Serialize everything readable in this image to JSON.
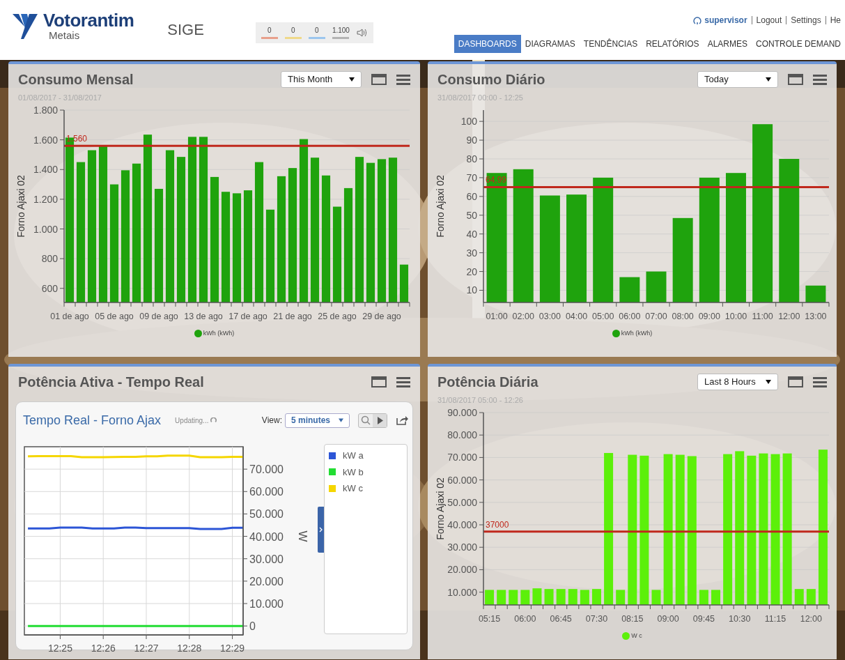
{
  "header": {
    "brand": "Votorantim",
    "brand_subtitle": "Metais",
    "app_name": "SIGE",
    "counters": [
      {
        "value": "0",
        "color": "#e8a08c"
      },
      {
        "value": "0",
        "color": "#efd98a"
      },
      {
        "value": "0",
        "color": "#9cc6ee"
      },
      {
        "value": "1.100",
        "color": "#b4b4b4"
      }
    ],
    "user": "supervisor",
    "links": [
      "Logout",
      "Settings",
      "He"
    ],
    "nav": [
      {
        "label": "DASHBOARDS",
        "selected": true
      },
      {
        "label": "DIAGRAMAS",
        "selected": false
      },
      {
        "label": "TENDÊNCIAS",
        "selected": false
      },
      {
        "label": "RELATÓRIOS",
        "selected": false
      },
      {
        "label": "ALARMES",
        "selected": false
      },
      {
        "label": "CONTROLE DEMAND",
        "selected": false
      }
    ]
  },
  "panels": [
    {
      "kind": "bar",
      "title": "Consumo Mensal",
      "period": "This Month",
      "date_range": "01/08/2017 - 31/08/2017",
      "chart_data": {
        "type": "bar",
        "ylabel": "Forno Ajaxi 02",
        "grid": true,
        "categories": [
          "01 de ago",
          null,
          null,
          null,
          "05 de ago",
          null,
          null,
          null,
          "09 de ago",
          null,
          null,
          null,
          "13 de ago",
          null,
          null,
          null,
          "17 de ago",
          null,
          null,
          null,
          "21 de ago",
          null,
          null,
          null,
          "25 de ago",
          null,
          null,
          null,
          "29 de ago",
          null,
          null
        ],
        "series": [
          {
            "name": "kWh (kWh)",
            "color": "#1fa30d",
            "values": [
              1615,
              1450,
              1530,
              1560,
              1300,
              1395,
              1440,
              1635,
              1270,
              1530,
              1485,
              1620,
              1620,
              1350,
              1250,
              1240,
              1260,
              1450,
              1130,
              1355,
              1410,
              1605,
              1480,
              1360,
              1150,
              1275,
              1485,
              1445,
              1470,
              1480,
              760
            ]
          }
        ],
        "ylim": [
          505,
          1800
        ],
        "yticks": [
          {
            "value": 600,
            "label": "600"
          },
          {
            "value": 800,
            "label": "800"
          },
          {
            "value": 1000,
            "label": "1.000"
          },
          {
            "value": 1200,
            "label": "1.200"
          },
          {
            "value": 1400,
            "label": "1.400"
          },
          {
            "value": 1600,
            "label": "1.600"
          },
          {
            "value": 1800,
            "label": "1.800"
          }
        ],
        "ref_lines": [
          {
            "axis": "y",
            "value": 1560,
            "label": "1.560",
            "color": "#c0281c"
          }
        ]
      }
    },
    {
      "kind": "bar",
      "title": "Consumo Diário",
      "period": "Today",
      "date_range": "31/08/2017 00:00 - 12:25",
      "chart_data": {
        "type": "bar",
        "ylabel": "Forno Ajaxi 02",
        "grid": true,
        "categories": [
          "01:00",
          "02:00",
          "03:00",
          "04:00",
          "05:00",
          "06:00",
          "07:00",
          "08:00",
          "09:00",
          "10:00",
          "11:00",
          "12:00",
          "13:00"
        ],
        "series": [
          {
            "name": "kWh (kWh)",
            "color": "#1fa30d",
            "values": [
              72.5,
              74.5,
              60.5,
              61,
              70,
              17,
              20,
              48.5,
              70,
              72.5,
              98.5,
              80,
              12.5
            ]
          }
        ],
        "ylim": [
          3.5,
          106
        ],
        "yticks": [
          10,
          20,
          30,
          40,
          50,
          60,
          70,
          80,
          90,
          100
        ],
        "ref_lines": [
          {
            "axis": "y",
            "value": 64.99,
            "label": "64,99",
            "color": "#c0281c"
          }
        ]
      }
    },
    {
      "kind": "realtime",
      "title": "Potência Ativa - Tempo Real",
      "card_title": "Tempo Real - Forno Ajax",
      "status": "Updating...",
      "view_label": "View:",
      "view_value": "5 minutes",
      "chart_data": {
        "type": "line",
        "ylabel": "W",
        "grid": true,
        "categories": [
          null,
          null,
          null,
          "12:25",
          null,
          null,
          null,
          "12:26",
          null,
          null,
          null,
          "12:27",
          null,
          null,
          null,
          "12:28",
          null,
          null,
          null,
          "12:29",
          null
        ],
        "series": [
          {
            "name": "kW a",
            "color": "#2c55d6",
            "values": [
              43500,
              43500,
              43500,
              43900,
              43900,
              43900,
              43500,
              43500,
              43500,
              43900,
              43900,
              43700,
              43700,
              43700,
              43700,
              43700,
              43300,
              43300,
              43300,
              43800,
              43800
            ]
          },
          {
            "name": "kW b",
            "color": "#22dd33",
            "values": [
              0,
              0,
              0,
              0,
              0,
              0,
              0,
              0,
              0,
              0,
              0,
              0,
              0,
              0,
              0,
              0,
              0,
              0,
              0,
              0,
              0
            ]
          },
          {
            "name": "kW c",
            "color": "#f5d600",
            "values": [
              75700,
              75800,
              75800,
              75800,
              75800,
              75300,
              75300,
              75300,
              75400,
              75500,
              75500,
              75700,
              75700,
              76000,
              76000,
              76000,
              75300,
              75300,
              75300,
              75500,
              75500
            ]
          }
        ],
        "ylim": [
          -4000,
          80000
        ],
        "yticks": [
          {
            "value": 0,
            "label": "0"
          },
          {
            "value": 10000,
            "label": "10.000"
          },
          {
            "value": 20000,
            "label": "20.000"
          },
          {
            "value": 30000,
            "label": "30.000"
          },
          {
            "value": 40000,
            "label": "40.000"
          },
          {
            "value": 50000,
            "label": "50.000"
          },
          {
            "value": 60000,
            "label": "60.000"
          },
          {
            "value": 70000,
            "label": "70.000"
          }
        ]
      }
    },
    {
      "kind": "bar",
      "title": "Potência Diária",
      "period": "Last 8 Hours",
      "date_range": "31/08/2017 05:00 - 12:26",
      "chart_data": {
        "type": "bar",
        "ylabel": "Forno Ajaxi 02",
        "grid": true,
        "categories": [
          "05:15",
          null,
          null,
          "06:00",
          null,
          null,
          "06:45",
          null,
          null,
          "07:30",
          null,
          null,
          "08:15",
          null,
          null,
          "09:00",
          null,
          null,
          "09:45",
          null,
          null,
          "10:30",
          null,
          null,
          "11:15",
          null,
          null,
          "12:00",
          null
        ],
        "series": [
          {
            "name": "W c",
            "color": "#5cf00a",
            "values": [
              11000,
              11000,
              11000,
              11000,
              11700,
              11400,
              11400,
              11400,
              11000,
              11400,
              72000,
              11000,
              71200,
              70800,
              11000,
              71500,
              71200,
              70600,
              11000,
              11000,
              71500,
              72800,
              70800,
              71800,
              71500,
              71800,
              11400,
              11400,
              73500
            ]
          }
        ],
        "ylim": [
          4300,
          90000
        ],
        "yticks": [
          {
            "value": 10000,
            "label": "10.000"
          },
          {
            "value": 20000,
            "label": "20.000"
          },
          {
            "value": 30000,
            "label": "30.000"
          },
          {
            "value": 40000,
            "label": "40.000"
          },
          {
            "value": 50000,
            "label": "50.000"
          },
          {
            "value": 60000,
            "label": "60.000"
          },
          {
            "value": 70000,
            "label": "70.000"
          },
          {
            "value": 80000,
            "label": "80.000"
          },
          {
            "value": 90000,
            "label": "90.000"
          }
        ],
        "ref_lines": [
          {
            "axis": "y",
            "value": 37000,
            "label": "37000",
            "color": "#c0281c"
          }
        ]
      }
    }
  ]
}
